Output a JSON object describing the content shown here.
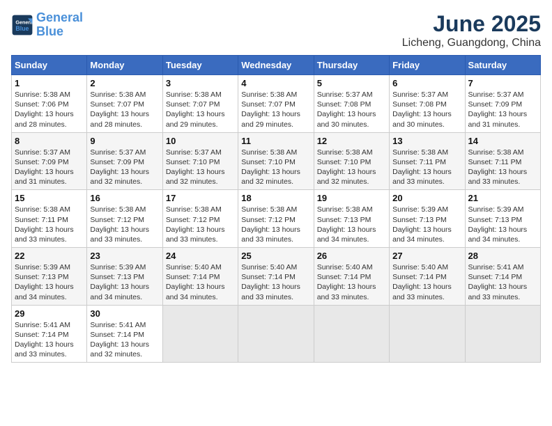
{
  "header": {
    "logo_line1": "General",
    "logo_line2": "Blue",
    "title": "June 2025",
    "subtitle": "Licheng, Guangdong, China"
  },
  "calendar": {
    "days_of_week": [
      "Sunday",
      "Monday",
      "Tuesday",
      "Wednesday",
      "Thursday",
      "Friday",
      "Saturday"
    ],
    "weeks": [
      [
        null,
        null,
        null,
        null,
        null,
        null,
        null
      ]
    ],
    "cells": [
      {
        "day": "1",
        "sunrise": "5:38 AM",
        "sunset": "7:06 PM",
        "daylight": "13 hours and 28 minutes.",
        "col": 0
      },
      {
        "day": "2",
        "sunrise": "5:38 AM",
        "sunset": "7:07 PM",
        "daylight": "13 hours and 28 minutes.",
        "col": 1
      },
      {
        "day": "3",
        "sunrise": "5:38 AM",
        "sunset": "7:07 PM",
        "daylight": "13 hours and 29 minutes.",
        "col": 2
      },
      {
        "day": "4",
        "sunrise": "5:38 AM",
        "sunset": "7:07 PM",
        "daylight": "13 hours and 29 minutes.",
        "col": 3
      },
      {
        "day": "5",
        "sunrise": "5:37 AM",
        "sunset": "7:08 PM",
        "daylight": "13 hours and 30 minutes.",
        "col": 4
      },
      {
        "day": "6",
        "sunrise": "5:37 AM",
        "sunset": "7:08 PM",
        "daylight": "13 hours and 30 minutes.",
        "col": 5
      },
      {
        "day": "7",
        "sunrise": "5:37 AM",
        "sunset": "7:09 PM",
        "daylight": "13 hours and 31 minutes.",
        "col": 6
      },
      {
        "day": "8",
        "sunrise": "5:37 AM",
        "sunset": "7:09 PM",
        "daylight": "13 hours and 31 minutes.",
        "col": 0
      },
      {
        "day": "9",
        "sunrise": "5:37 AM",
        "sunset": "7:09 PM",
        "daylight": "13 hours and 32 minutes.",
        "col": 1
      },
      {
        "day": "10",
        "sunrise": "5:37 AM",
        "sunset": "7:10 PM",
        "daylight": "13 hours and 32 minutes.",
        "col": 2
      },
      {
        "day": "11",
        "sunrise": "5:38 AM",
        "sunset": "7:10 PM",
        "daylight": "13 hours and 32 minutes.",
        "col": 3
      },
      {
        "day": "12",
        "sunrise": "5:38 AM",
        "sunset": "7:10 PM",
        "daylight": "13 hours and 32 minutes.",
        "col": 4
      },
      {
        "day": "13",
        "sunrise": "5:38 AM",
        "sunset": "7:11 PM",
        "daylight": "13 hours and 33 minutes.",
        "col": 5
      },
      {
        "day": "14",
        "sunrise": "5:38 AM",
        "sunset": "7:11 PM",
        "daylight": "13 hours and 33 minutes.",
        "col": 6
      },
      {
        "day": "15",
        "sunrise": "5:38 AM",
        "sunset": "7:11 PM",
        "daylight": "13 hours and 33 minutes.",
        "col": 0
      },
      {
        "day": "16",
        "sunrise": "5:38 AM",
        "sunset": "7:12 PM",
        "daylight": "13 hours and 33 minutes.",
        "col": 1
      },
      {
        "day": "17",
        "sunrise": "5:38 AM",
        "sunset": "7:12 PM",
        "daylight": "13 hours and 33 minutes.",
        "col": 2
      },
      {
        "day": "18",
        "sunrise": "5:38 AM",
        "sunset": "7:12 PM",
        "daylight": "13 hours and 33 minutes.",
        "col": 3
      },
      {
        "day": "19",
        "sunrise": "5:38 AM",
        "sunset": "7:13 PM",
        "daylight": "13 hours and 34 minutes.",
        "col": 4
      },
      {
        "day": "20",
        "sunrise": "5:39 AM",
        "sunset": "7:13 PM",
        "daylight": "13 hours and 34 minutes.",
        "col": 5
      },
      {
        "day": "21",
        "sunrise": "5:39 AM",
        "sunset": "7:13 PM",
        "daylight": "13 hours and 34 minutes.",
        "col": 6
      },
      {
        "day": "22",
        "sunrise": "5:39 AM",
        "sunset": "7:13 PM",
        "daylight": "13 hours and 34 minutes.",
        "col": 0
      },
      {
        "day": "23",
        "sunrise": "5:39 AM",
        "sunset": "7:13 PM",
        "daylight": "13 hours and 34 minutes.",
        "col": 1
      },
      {
        "day": "24",
        "sunrise": "5:40 AM",
        "sunset": "7:14 PM",
        "daylight": "13 hours and 34 minutes.",
        "col": 2
      },
      {
        "day": "25",
        "sunrise": "5:40 AM",
        "sunset": "7:14 PM",
        "daylight": "13 hours and 33 minutes.",
        "col": 3
      },
      {
        "day": "26",
        "sunrise": "5:40 AM",
        "sunset": "7:14 PM",
        "daylight": "13 hours and 33 minutes.",
        "col": 4
      },
      {
        "day": "27",
        "sunrise": "5:40 AM",
        "sunset": "7:14 PM",
        "daylight": "13 hours and 33 minutes.",
        "col": 5
      },
      {
        "day": "28",
        "sunrise": "5:41 AM",
        "sunset": "7:14 PM",
        "daylight": "13 hours and 33 minutes.",
        "col": 6
      },
      {
        "day": "29",
        "sunrise": "5:41 AM",
        "sunset": "7:14 PM",
        "daylight": "13 hours and 33 minutes.",
        "col": 0
      },
      {
        "day": "30",
        "sunrise": "5:41 AM",
        "sunset": "7:14 PM",
        "daylight": "13 hours and 32 minutes.",
        "col": 1
      }
    ]
  }
}
